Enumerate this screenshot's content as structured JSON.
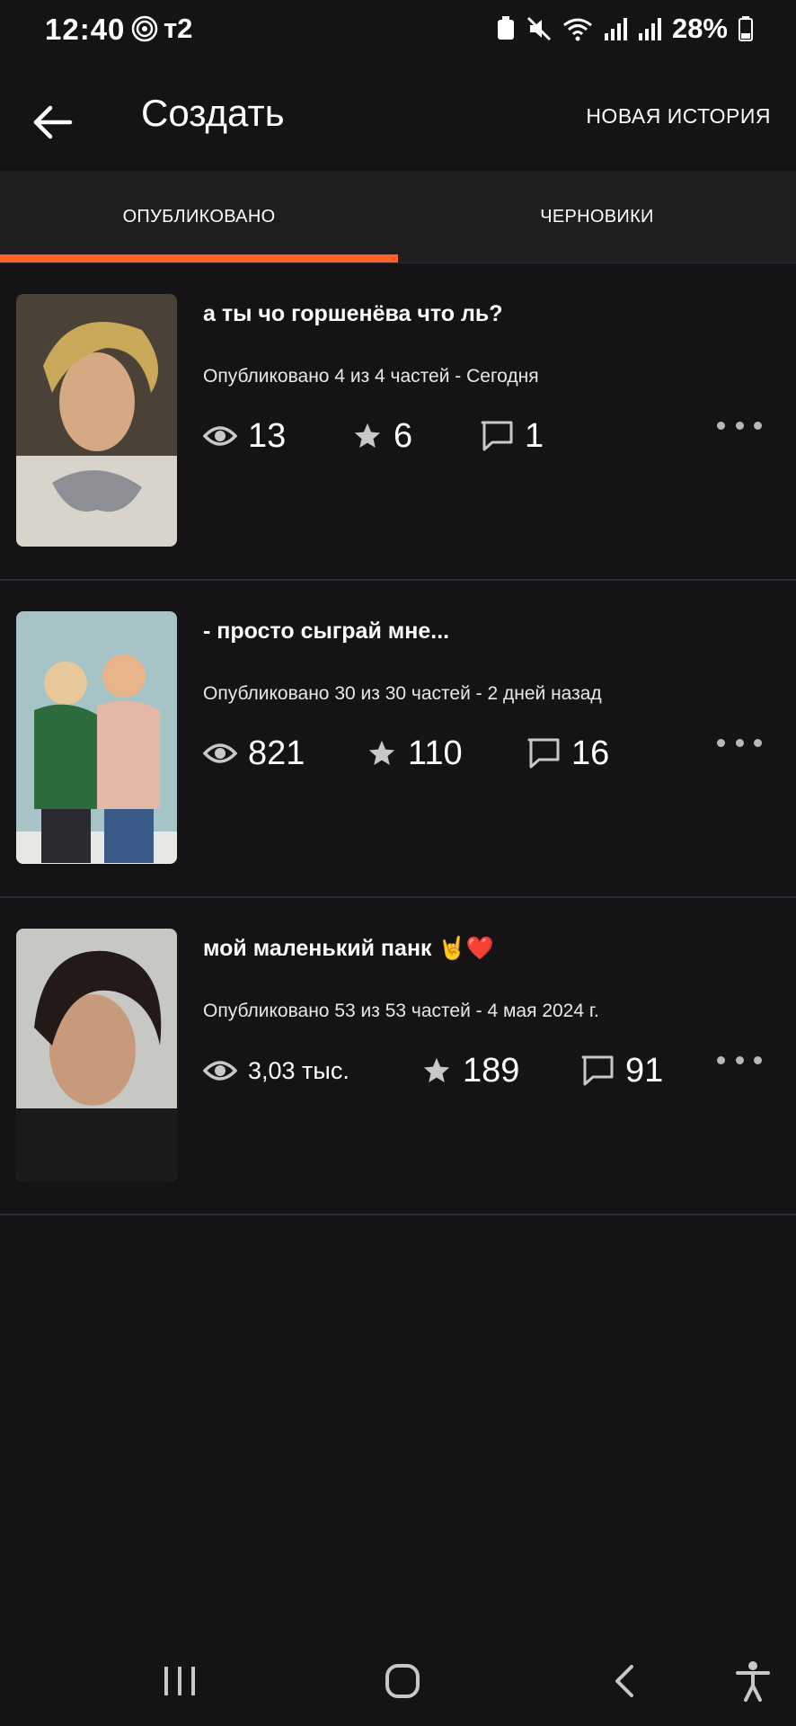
{
  "status_bar": {
    "time": "12:40",
    "carrier": "т2",
    "battery": "28%"
  },
  "header": {
    "title": "Создать",
    "new_story": "НОВАЯ ИСТОРИЯ"
  },
  "tabs": [
    {
      "label": "ОПУБЛИКОВАНО",
      "active": true
    },
    {
      "label": "ЧЕРНОВИКИ",
      "active": false
    }
  ],
  "colors": {
    "accent": "#ff6122",
    "background": "#151316",
    "tab_bar": "#1f1d20"
  },
  "stories": [
    {
      "title": "а ты чо горшенёва что ль?",
      "meta": "Опубликовано 4 из 4 частей - Сегодня",
      "views": "13",
      "votes": "6",
      "comments": "1"
    },
    {
      "title": "- просто сыграй мне...",
      "meta": "Опубликовано 30 из 30 частей - 2 дней назад",
      "views": "821",
      "votes": "110",
      "comments": "16"
    },
    {
      "title": "мой маленький панк 🤘❤️",
      "meta": "Опубликовано 53 из 53 частей - 4 мая 2024 г.",
      "views": "3,03 тыс.",
      "votes": "189",
      "comments": "91"
    }
  ],
  "icons": {
    "views": "eye-icon",
    "votes": "star-icon",
    "comments": "comment-icon",
    "more": "more-dots-icon"
  }
}
